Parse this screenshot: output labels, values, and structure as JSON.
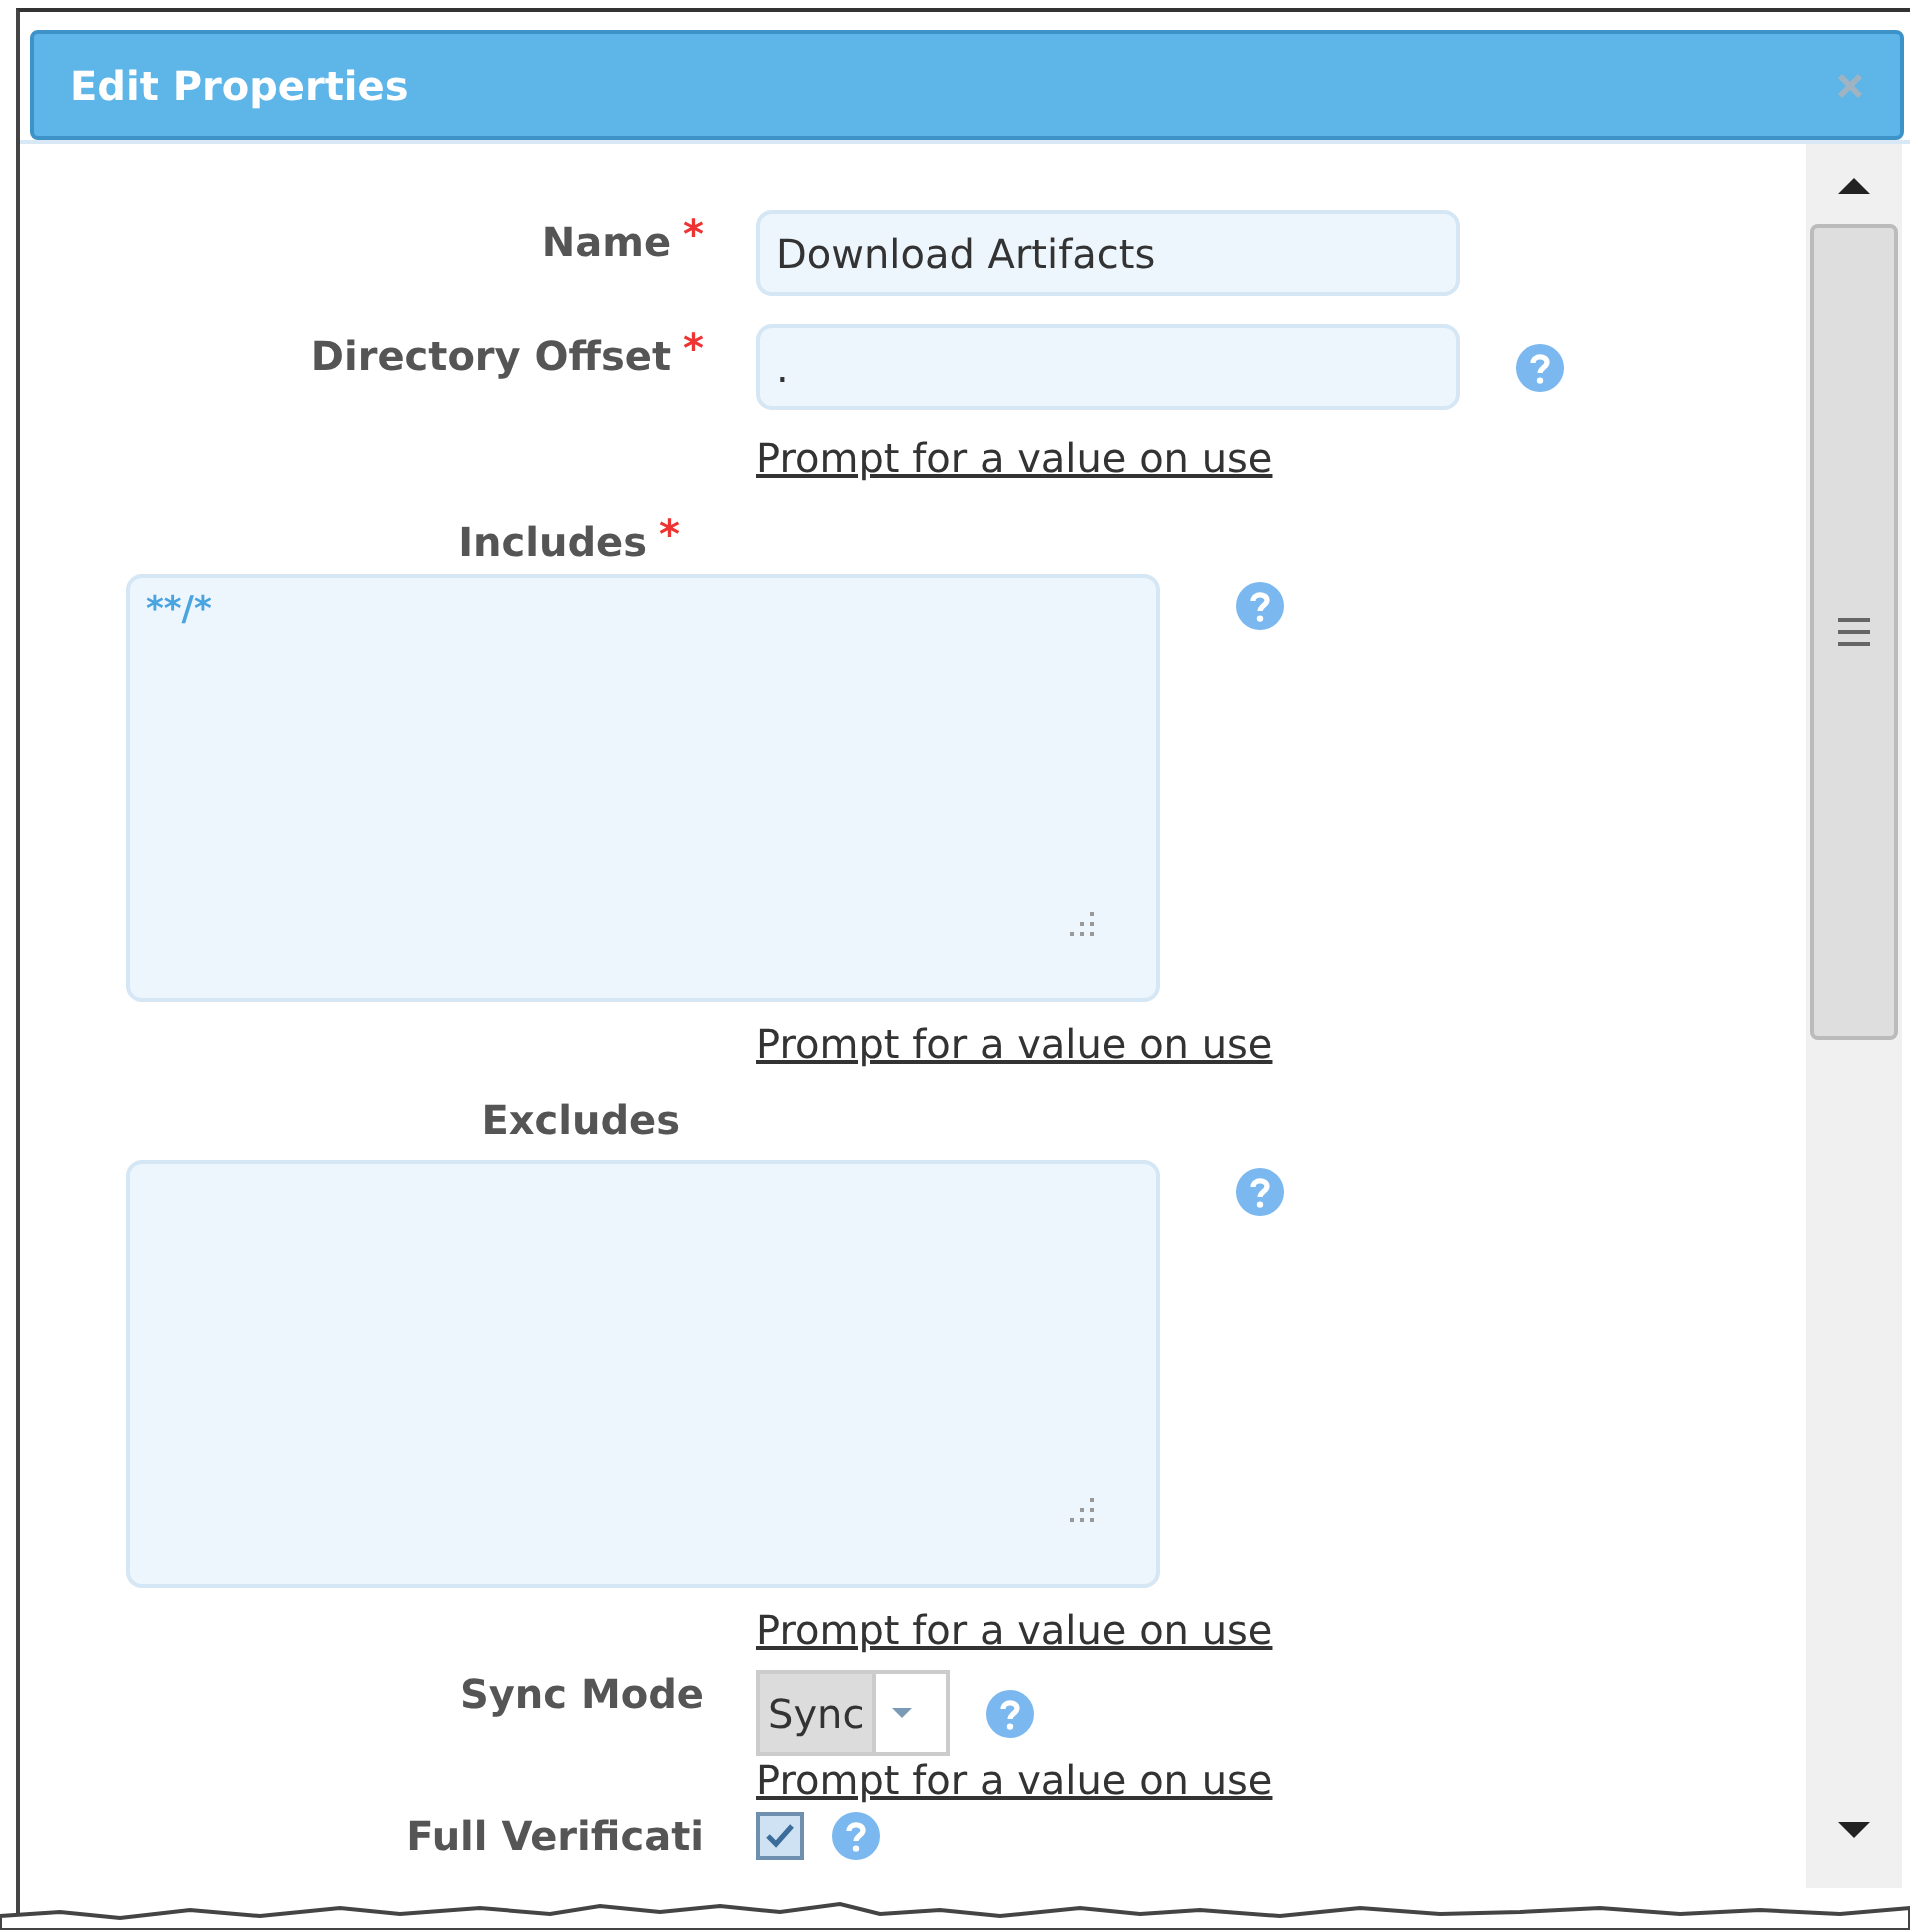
{
  "dialog": {
    "title": "Edit Properties"
  },
  "fields": [
    {
      "kind": "text",
      "label": "Name",
      "required_mark": "*",
      "value": "Download Artifacts",
      "help": false
    },
    {
      "kind": "text",
      "label": "Directory Offset",
      "required_mark": "*",
      "value": ".",
      "help": true,
      "prompt": "Prompt for a value on use"
    },
    {
      "kind": "textarea",
      "label": "Includes",
      "required_mark": "*",
      "value": "**/*",
      "help": true,
      "prompt": "Prompt for a value on use"
    },
    {
      "kind": "textarea",
      "label": "Excludes",
      "help": true,
      "prompt": "Prompt for a value on use"
    },
    {
      "kind": "select",
      "label": "Sync Mode",
      "value": "Sync",
      "help": true,
      "prompt": "Prompt for a value on use"
    },
    {
      "kind": "checkbox",
      "label": "Full Verificati",
      "checked": true,
      "help": true
    }
  ]
}
